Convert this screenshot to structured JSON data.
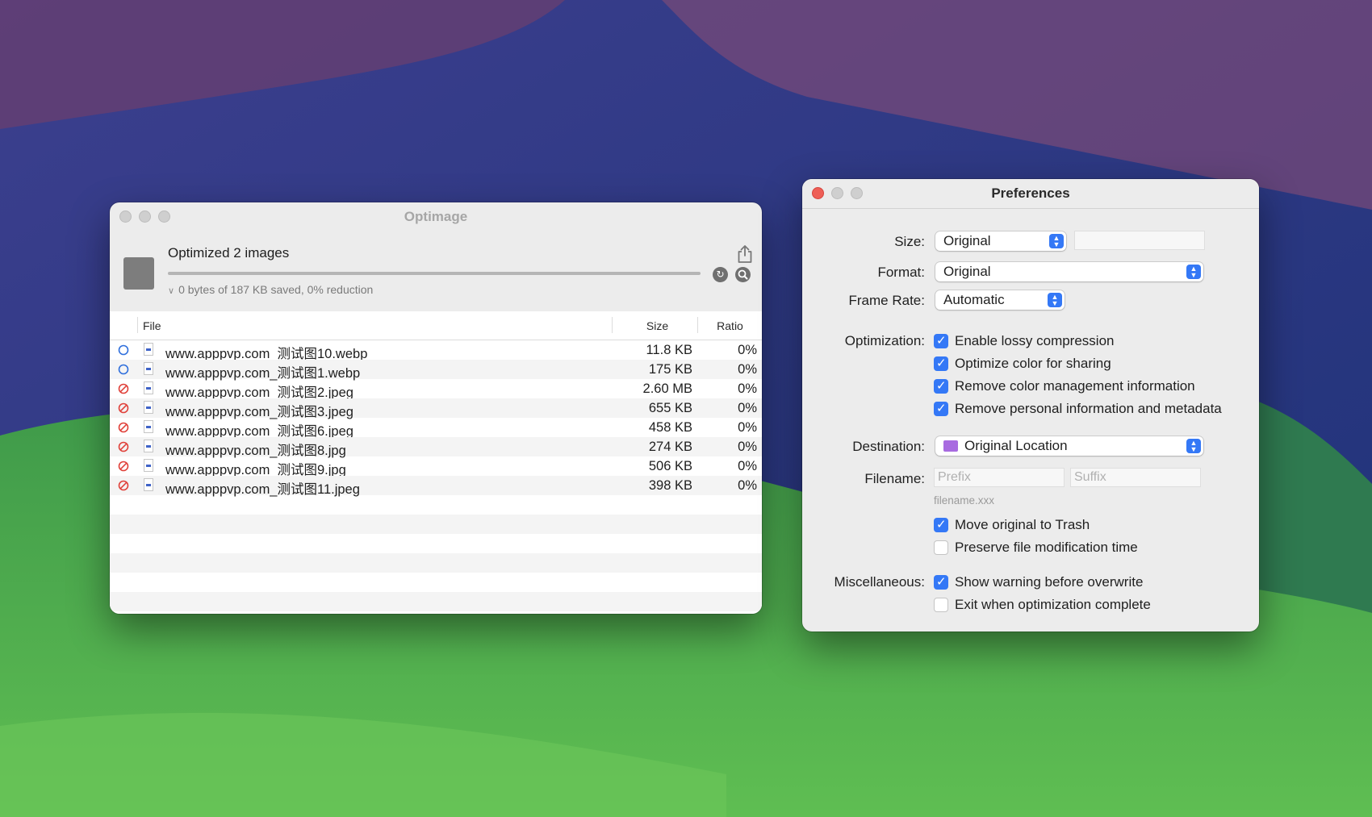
{
  "optimage": {
    "title": "Optimage",
    "summary_title": "Optimized 2 images",
    "summary_sub": "0 bytes of 187 KB saved, 0% reduction",
    "progress": 1.0,
    "columns": {
      "file": "File",
      "size": "Size",
      "ratio": "Ratio"
    },
    "rows": [
      {
        "status": "pending",
        "name": "www.apppvp.com_测试图10.webp",
        "size": "11.8 KB",
        "ratio": "0%"
      },
      {
        "status": "pending",
        "name": "www.apppvp.com_测试图1.webp",
        "size": "175 KB",
        "ratio": "0%"
      },
      {
        "status": "error",
        "name": "www.apppvp.com_测试图2.jpeg",
        "size": "2.60 MB",
        "ratio": "0%"
      },
      {
        "status": "error",
        "name": "www.apppvp.com_测试图3.jpeg",
        "size": "655 KB",
        "ratio": "0%"
      },
      {
        "status": "error",
        "name": "www.apppvp.com_测试图6.jpeg",
        "size": "458 KB",
        "ratio": "0%"
      },
      {
        "status": "error",
        "name": "www.apppvp.com_测试图8.jpg",
        "size": "274 KB",
        "ratio": "0%"
      },
      {
        "status": "error",
        "name": "www.apppvp.com_测试图9.jpg",
        "size": "506 KB",
        "ratio": "0%"
      },
      {
        "status": "error",
        "name": "www.apppvp.com_测试图11.jpeg",
        "size": "398 KB",
        "ratio": "0%"
      }
    ]
  },
  "prefs": {
    "title": "Preferences",
    "size_label": "Size:",
    "size_value": "Original",
    "format_label": "Format:",
    "format_value": "Original",
    "frame_rate_label": "Frame Rate:",
    "frame_rate_value": "Automatic",
    "optimization_label": "Optimization:",
    "optimization_options": [
      {
        "label": "Enable lossy compression",
        "checked": true
      },
      {
        "label": "Optimize color for sharing",
        "checked": true
      },
      {
        "label": "Remove color management information",
        "checked": true
      },
      {
        "label": "Remove personal information and metadata",
        "checked": true
      }
    ],
    "destination_label": "Destination:",
    "destination_value": "Original Location",
    "filename_label": "Filename:",
    "prefix_placeholder": "Prefix",
    "suffix_placeholder": "Suffix",
    "filename_hint": "filename.xxx",
    "file_options": [
      {
        "label": "Move original to Trash",
        "checked": true
      },
      {
        "label": "Preserve file modification time",
        "checked": false
      }
    ],
    "misc_label": "Miscellaneous:",
    "misc_options": [
      {
        "label": "Show warning before overwrite",
        "checked": true
      },
      {
        "label": "Exit when optimization complete",
        "checked": false
      }
    ]
  },
  "colors": {
    "accent": "#3478f6",
    "error": "#e0413a",
    "pending": "#2f6fdc",
    "close_button": "#ee5f57"
  }
}
